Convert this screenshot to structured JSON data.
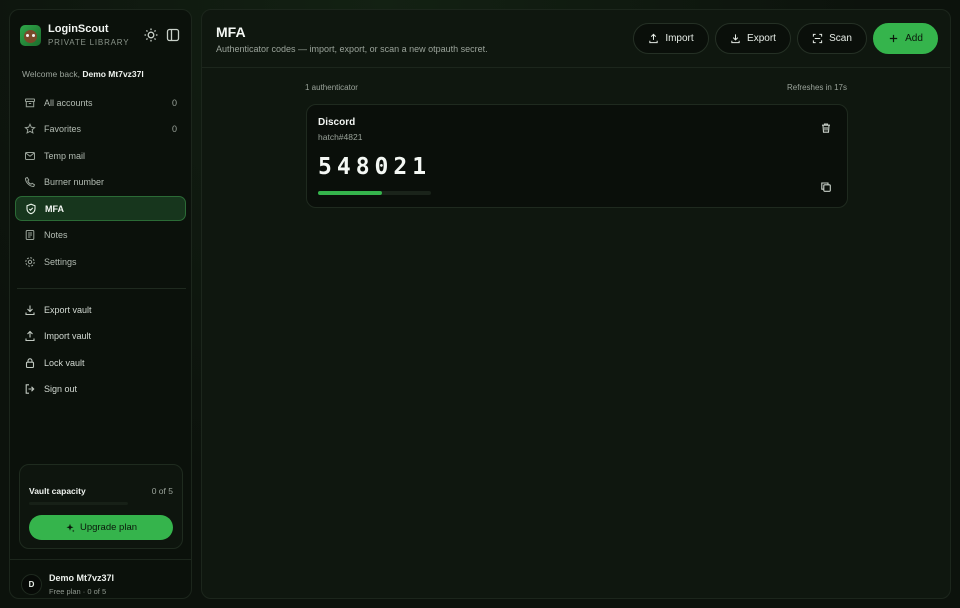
{
  "brand": {
    "name": "LoginScout",
    "subtitle": "PRIVATE LIBRARY"
  },
  "welcome": {
    "prefix": "Welcome back,",
    "user": "Demo Mt7vz37l"
  },
  "nav": [
    {
      "label": "All accounts",
      "icon": "archive-icon",
      "count": "0"
    },
    {
      "label": "Favorites",
      "icon": "star-icon",
      "count": "0"
    },
    {
      "label": "Temp mail",
      "icon": "mail-icon"
    },
    {
      "label": "Burner number",
      "icon": "phone-icon"
    },
    {
      "label": "MFA",
      "icon": "shield-icon",
      "active": true
    },
    {
      "label": "Notes",
      "icon": "notes-icon"
    },
    {
      "label": "Settings",
      "icon": "gear-icon"
    }
  ],
  "nav_actions": [
    {
      "label": "Export vault",
      "icon": "download-icon"
    },
    {
      "label": "Import vault",
      "icon": "upload-icon"
    },
    {
      "label": "Lock vault",
      "icon": "lock-icon"
    },
    {
      "label": "Sign out",
      "icon": "sign-out-icon"
    }
  ],
  "capacity": {
    "title": "Vault capacity",
    "count": "0 of 5",
    "fraction": 0,
    "upgrade_label": "Upgrade plan"
  },
  "user": {
    "initial": "D",
    "name": "Demo Mt7vz37l",
    "plan": "Free plan · 0 of 5"
  },
  "page": {
    "title": "MFA",
    "subtitle": "Authenticator codes — import, export, or scan a new otpauth secret."
  },
  "toolbar": {
    "import_label": "Import",
    "export_label": "Export",
    "scan_label": "Scan",
    "add_label": "Add"
  },
  "list": {
    "count_label": "1 authenticator",
    "refresh_label": "Refreshes in 17s"
  },
  "authenticators": [
    {
      "name": "Discord",
      "account": "hatch#4821",
      "code": "548021",
      "progress": 0.57
    }
  ],
  "colors": {
    "accent": "#35b44c",
    "active_bg": "#17361d",
    "background": "#0d130d"
  }
}
